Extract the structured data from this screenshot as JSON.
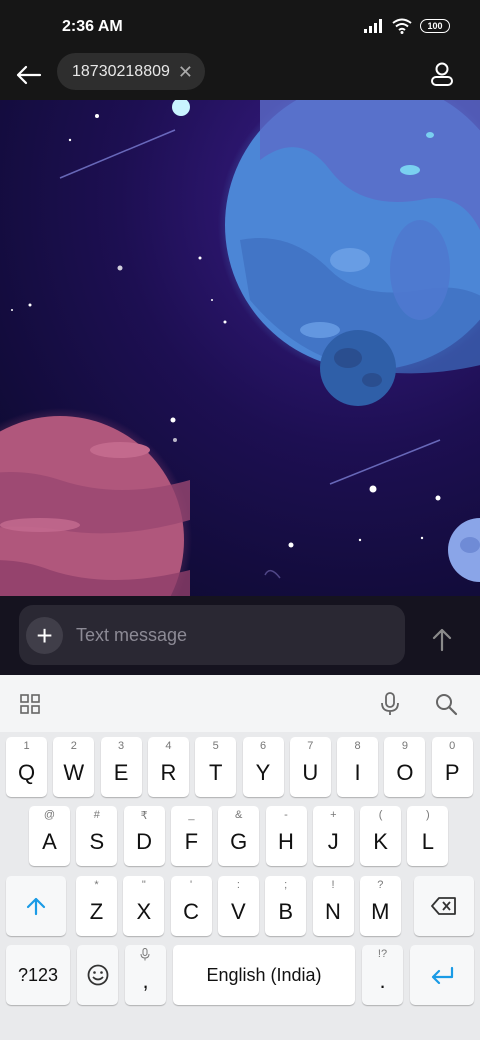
{
  "status_bar": {
    "time": "2:36 AM",
    "battery": "100"
  },
  "app_bar": {
    "recipient": "18730218809",
    "chip_close": "✕"
  },
  "compose": {
    "placeholder": "Text message",
    "add_glyph": "+"
  },
  "keyboard": {
    "row1": [
      {
        "hint": "1",
        "label": "Q"
      },
      {
        "hint": "2",
        "label": "W"
      },
      {
        "hint": "3",
        "label": "E"
      },
      {
        "hint": "4",
        "label": "R"
      },
      {
        "hint": "5",
        "label": "T"
      },
      {
        "hint": "6",
        "label": "Y"
      },
      {
        "hint": "7",
        "label": "U"
      },
      {
        "hint": "8",
        "label": "I"
      },
      {
        "hint": "9",
        "label": "O"
      },
      {
        "hint": "0",
        "label": "P"
      }
    ],
    "row2": [
      {
        "hint": "@",
        "label": "A"
      },
      {
        "hint": "#",
        "label": "S"
      },
      {
        "hint": "₹",
        "label": "D"
      },
      {
        "hint": "_",
        "label": "F"
      },
      {
        "hint": "&",
        "label": "G"
      },
      {
        "hint": "-",
        "label": "H"
      },
      {
        "hint": "+",
        "label": "J"
      },
      {
        "hint": "(",
        "label": "K"
      },
      {
        "hint": ")",
        "label": "L"
      }
    ],
    "row3": [
      {
        "hint": "*",
        "label": "Z"
      },
      {
        "hint": "\"",
        "label": "X"
      },
      {
        "hint": "'",
        "label": "C"
      },
      {
        "hint": ":",
        "label": "V"
      },
      {
        "hint": ";",
        "label": "B"
      },
      {
        "hint": "!",
        "label": "N"
      },
      {
        "hint": "?",
        "label": "M"
      }
    ],
    "symbols_key": "?123",
    "comma_key": ",",
    "space_key": "English (India)",
    "period_hint": "!?",
    "period_key": "."
  },
  "colors": {
    "accent_blue": "#1a9be6",
    "space_bg": "#1a0f45",
    "planet_blue": "#4a7fd4",
    "planet_pink": "#b0587c"
  },
  "icons": {
    "back": "back-arrow-icon",
    "contact": "person-icon",
    "send": "send-arrow-icon",
    "apps": "grid-icon",
    "mic": "microphone-icon",
    "search": "search-icon",
    "shift": "shift-icon",
    "backspace": "backspace-icon",
    "emoji": "emoji-icon",
    "enter": "enter-icon"
  }
}
